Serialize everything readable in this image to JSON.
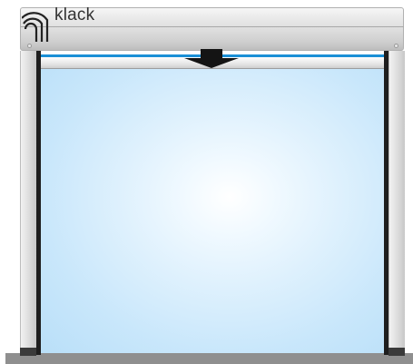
{
  "brand": {
    "label": "klack",
    "logo_icon": "signal-waves-icon"
  },
  "status": {
    "motion_icon": "arrow-down-icon",
    "motion_direction": "down"
  },
  "colors": {
    "screen_tint": "#c9e7fb",
    "indicator_line": "#1a8fd6",
    "rail_dark": "#1e1e1e",
    "floor": "#8f8f8f"
  }
}
